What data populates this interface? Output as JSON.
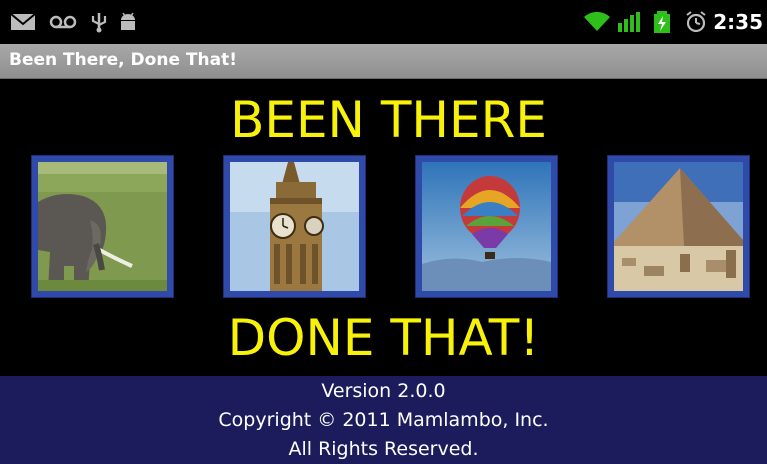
{
  "status_bar": {
    "icons_left": [
      "mail-icon",
      "voicemail-icon",
      "usb-icon",
      "android-debug-icon"
    ],
    "icons_right": [
      "wifi-icon",
      "signal-icon",
      "battery-charging-icon",
      "alarm-icon"
    ],
    "time": "2:35"
  },
  "app_bar": {
    "title": "Been There, Done That!"
  },
  "main": {
    "headline_top": "BEEN THERE",
    "headline_bottom": "DONE THAT!",
    "tiles": [
      {
        "icon": "elephant-photo"
      },
      {
        "icon": "big-ben-photo"
      },
      {
        "icon": "hot-air-balloon-photo"
      },
      {
        "icon": "pyramid-photo"
      }
    ]
  },
  "footer": {
    "version": "Version 2.0.0",
    "copyright": "Copyright © 2011 Mamlambo, Inc.",
    "rights": "All Rights Reserved."
  },
  "colors": {
    "headline": "#f8f20a",
    "tile_frame": "#2f4aa8",
    "footer_bg": "#1c1c5c",
    "title_bar": "#9c9c9c"
  }
}
